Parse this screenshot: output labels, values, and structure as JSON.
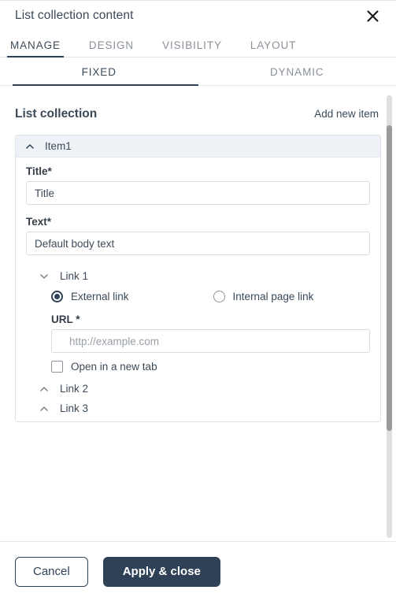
{
  "dialog": {
    "title": "List collection content",
    "close_icon": "close-icon"
  },
  "tabs_primary": [
    {
      "label": "MANAGE",
      "active": true
    },
    {
      "label": "DESIGN",
      "active": false
    },
    {
      "label": "VISIBILITY",
      "active": false
    },
    {
      "label": "LAYOUT",
      "active": false
    }
  ],
  "tabs_secondary": [
    {
      "label": "FIXED",
      "active": true
    },
    {
      "label": "DYNAMIC",
      "active": false
    }
  ],
  "section": {
    "title": "List collection",
    "add_new_item_label": "Add new item"
  },
  "item": {
    "header_label": "Item1",
    "header_chevron_icon": "chevron-up-icon",
    "fields": {
      "title": {
        "label": "Title*",
        "value": "Title",
        "placeholder": "Title"
      },
      "text": {
        "label": "Text*",
        "value": "Default body text",
        "placeholder": "Default body text"
      }
    },
    "links": [
      {
        "label": "Link 1",
        "chevron_icon": "chevron-down-icon",
        "expanded": true,
        "radio_options": [
          {
            "label": "External link",
            "checked": true
          },
          {
            "label": "Internal page link",
            "checked": false
          }
        ],
        "url": {
          "label": "URL *",
          "value": "",
          "placeholder": "http://example.com"
        },
        "checkbox": {
          "label": "Open in a new tab",
          "checked": false
        }
      },
      {
        "label": "Link 2",
        "chevron_icon": "chevron-up-icon",
        "expanded": false
      },
      {
        "label": "Link 3",
        "chevron_icon": "chevron-up-icon",
        "expanded": false
      }
    ]
  },
  "footer": {
    "cancel_label": "Cancel",
    "apply_label": "Apply & close"
  },
  "colors": {
    "accent": "#2f4156",
    "item_header_bg": "#eef2f7",
    "border": "#e6e6e6",
    "muted_text": "#8a9099",
    "scrollbar_thumb": "#9a9a9a"
  }
}
